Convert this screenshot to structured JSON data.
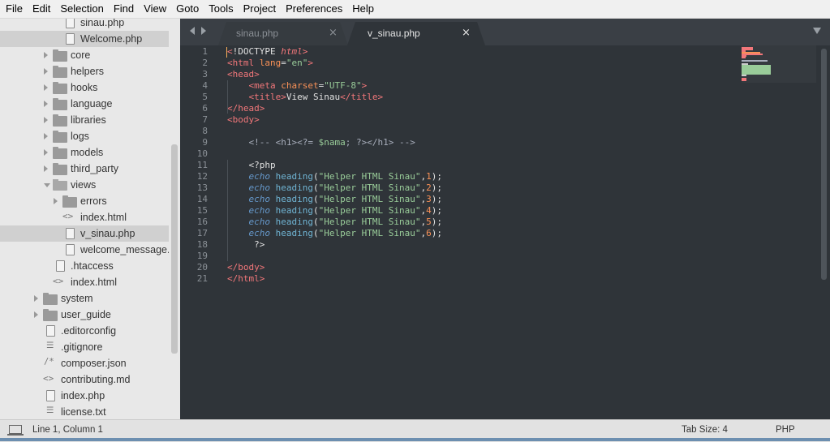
{
  "menu": {
    "items": [
      "File",
      "Edit",
      "Selection",
      "Find",
      "View",
      "Goto",
      "Tools",
      "Project",
      "Preferences",
      "Help"
    ]
  },
  "sidebar": {
    "items": [
      {
        "label": "sinau.php",
        "type": "file",
        "depth": 2
      },
      {
        "label": "Welcome.php",
        "type": "file",
        "depth": 2,
        "selected": true
      },
      {
        "label": "core",
        "type": "folder",
        "depth": 1
      },
      {
        "label": "helpers",
        "type": "folder",
        "depth": 1
      },
      {
        "label": "hooks",
        "type": "folder",
        "depth": 1
      },
      {
        "label": "language",
        "type": "folder",
        "depth": 1
      },
      {
        "label": "libraries",
        "type": "folder",
        "depth": 1
      },
      {
        "label": "logs",
        "type": "folder",
        "depth": 1
      },
      {
        "label": "models",
        "type": "folder",
        "depth": 1
      },
      {
        "label": "third_party",
        "type": "folder",
        "depth": 1
      },
      {
        "label": "views",
        "type": "folder-open",
        "depth": 1
      },
      {
        "label": "errors",
        "type": "folder",
        "depth": 2
      },
      {
        "label": "index.html",
        "type": "code",
        "depth": 2
      },
      {
        "label": "v_sinau.php",
        "type": "file",
        "depth": 2,
        "selected": true
      },
      {
        "label": "welcome_message.p",
        "type": "file",
        "depth": 2
      },
      {
        "label": ".htaccess",
        "type": "file",
        "depth": 1
      },
      {
        "label": "index.html",
        "type": "code",
        "depth": 1
      },
      {
        "label": "system",
        "type": "folder",
        "depth": 0
      },
      {
        "label": "user_guide",
        "type": "folder",
        "depth": 0
      },
      {
        "label": ".editorconfig",
        "type": "file",
        "depth": 0
      },
      {
        "label": ".gitignore",
        "type": "lines",
        "depth": 0
      },
      {
        "label": "composer.json",
        "type": "comment",
        "depth": 0
      },
      {
        "label": "contributing.md",
        "type": "code",
        "depth": 0
      },
      {
        "label": "index.php",
        "type": "file",
        "depth": 0
      },
      {
        "label": "license.txt",
        "type": "lines",
        "depth": 0
      }
    ]
  },
  "tabs": [
    {
      "label": "sinau.php",
      "close": "×",
      "active": false
    },
    {
      "label": "v_sinau.php",
      "close": "×",
      "active": true
    }
  ],
  "editor": {
    "lines": [
      [
        [
          "c-tag",
          "<"
        ],
        [
          "c-text",
          "!DOCTYPE "
        ],
        [
          "c-itl",
          "html"
        ],
        [
          "c-tag",
          ">"
        ]
      ],
      [
        [
          "c-tag",
          "<html "
        ],
        [
          "c-attr",
          "lang"
        ],
        [
          "c-text",
          "="
        ],
        [
          "c-str",
          "\"en\""
        ],
        [
          "c-tag",
          ">"
        ]
      ],
      [
        [
          "c-tag",
          "<head>"
        ]
      ],
      [
        [
          "c-text",
          "    "
        ],
        [
          "c-tag",
          "<meta "
        ],
        [
          "c-attr",
          "charset"
        ],
        [
          "c-text",
          "="
        ],
        [
          "c-str",
          "\"UTF-8\""
        ],
        [
          "c-tag",
          ">"
        ]
      ],
      [
        [
          "c-text",
          "    "
        ],
        [
          "c-tag",
          "<title>"
        ],
        [
          "c-text",
          "View Sinau"
        ],
        [
          "c-tag",
          "</title>"
        ]
      ],
      [
        [
          "c-tag",
          "</head>"
        ]
      ],
      [
        [
          "c-tag",
          "<body>"
        ]
      ],
      [
        [
          "c-text",
          ""
        ]
      ],
      [
        [
          "c-text",
          "    "
        ],
        [
          "c-cmt",
          "<!-- <h1><?= "
        ],
        [
          "c-var",
          "$nama"
        ],
        [
          "c-cmt",
          "; ?></h1> -->"
        ]
      ],
      [
        [
          "c-text",
          ""
        ]
      ],
      [
        [
          "c-text",
          "    <?php"
        ]
      ],
      [
        [
          "c-text",
          "    "
        ],
        [
          "c-kw",
          "echo"
        ],
        [
          "c-text",
          " "
        ],
        [
          "c-fn",
          "heading"
        ],
        [
          "c-text",
          "("
        ],
        [
          "c-str",
          "\"Helper HTML Sinau\""
        ],
        [
          "c-text",
          ","
        ],
        [
          "c-num",
          "1"
        ],
        [
          "c-text",
          ");"
        ]
      ],
      [
        [
          "c-text",
          "    "
        ],
        [
          "c-kw",
          "echo"
        ],
        [
          "c-text",
          " "
        ],
        [
          "c-fn",
          "heading"
        ],
        [
          "c-text",
          "("
        ],
        [
          "c-str",
          "\"Helper HTML Sinau\""
        ],
        [
          "c-text",
          ","
        ],
        [
          "c-num",
          "2"
        ],
        [
          "c-text",
          ");"
        ]
      ],
      [
        [
          "c-text",
          "    "
        ],
        [
          "c-kw",
          "echo"
        ],
        [
          "c-text",
          " "
        ],
        [
          "c-fn",
          "heading"
        ],
        [
          "c-text",
          "("
        ],
        [
          "c-str",
          "\"Helper HTML Sinau\""
        ],
        [
          "c-text",
          ","
        ],
        [
          "c-num",
          "3"
        ],
        [
          "c-text",
          ");"
        ]
      ],
      [
        [
          "c-text",
          "    "
        ],
        [
          "c-kw",
          "echo"
        ],
        [
          "c-text",
          " "
        ],
        [
          "c-fn",
          "heading"
        ],
        [
          "c-text",
          "("
        ],
        [
          "c-str",
          "\"Helper HTML Sinau\""
        ],
        [
          "c-text",
          ","
        ],
        [
          "c-num",
          "4"
        ],
        [
          "c-text",
          ");"
        ]
      ],
      [
        [
          "c-text",
          "    "
        ],
        [
          "c-kw",
          "echo"
        ],
        [
          "c-text",
          " "
        ],
        [
          "c-fn",
          "heading"
        ],
        [
          "c-text",
          "("
        ],
        [
          "c-str",
          "\"Helper HTML Sinau\""
        ],
        [
          "c-text",
          ","
        ],
        [
          "c-num",
          "5"
        ],
        [
          "c-text",
          ");"
        ]
      ],
      [
        [
          "c-text",
          "    "
        ],
        [
          "c-kw",
          "echo"
        ],
        [
          "c-text",
          " "
        ],
        [
          "c-fn",
          "heading"
        ],
        [
          "c-text",
          "("
        ],
        [
          "c-str",
          "\"Helper HTML Sinau\""
        ],
        [
          "c-text",
          ","
        ],
        [
          "c-num",
          "6"
        ],
        [
          "c-text",
          ");"
        ]
      ],
      [
        [
          "c-text",
          "     ?>"
        ]
      ],
      [
        [
          "c-text",
          ""
        ]
      ],
      [
        [
          "c-tag",
          "</body>"
        ]
      ],
      [
        [
          "c-tag",
          "</html>"
        ]
      ]
    ]
  },
  "status": {
    "position": "Line 1, Column 1",
    "tab_size": "Tab Size: 4",
    "syntax": "PHP"
  },
  "colors": {
    "editor_bg": "#2f3439",
    "sidebar_bg": "#e8e8e8",
    "tag": "#f2777a",
    "string": "#99cc99",
    "keyword": "#6699cc",
    "cursor": "#f9ae58"
  }
}
